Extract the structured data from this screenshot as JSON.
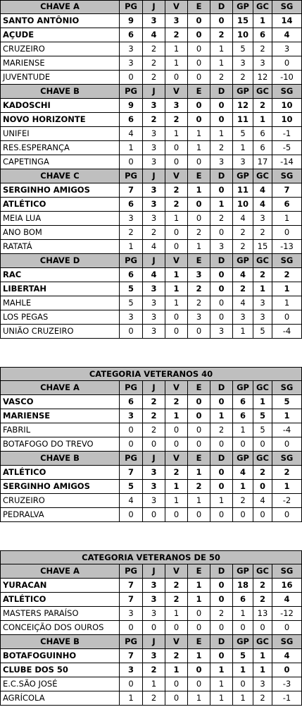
{
  "columns": [
    "PG",
    "J",
    "V",
    "E",
    "D",
    "GP",
    "GC",
    "SG"
  ],
  "sections": [
    {
      "category": "",
      "groups": [
        {
          "title": "CHAVE  A",
          "teams": [
            {
              "name": "SANTO ANTÔNIO",
              "bold": true,
              "stats": [
                "9",
                "3",
                "3",
                "0",
                "0",
                "15",
                "1",
                "14"
              ]
            },
            {
              "name": "AÇUDE",
              "bold": true,
              "stats": [
                "6",
                "4",
                "2",
                "0",
                "2",
                "10",
                "6",
                "4"
              ]
            },
            {
              "name": "CRUZEIRO",
              "bold": false,
              "stats": [
                "3",
                "2",
                "1",
                "0",
                "1",
                "5",
                "2",
                "3"
              ]
            },
            {
              "name": "MARIENSE",
              "bold": false,
              "stats": [
                "3",
                "2",
                "1",
                "0",
                "1",
                "3",
                "3",
                "0"
              ]
            },
            {
              "name": "JUVENTUDE",
              "bold": false,
              "stats": [
                "0",
                "2",
                "0",
                "0",
                "2",
                "2",
                "12",
                "-10"
              ]
            }
          ]
        },
        {
          "title": "CHAVE  B",
          "teams": [
            {
              "name": "KADOSCHI",
              "bold": true,
              "stats": [
                "9",
                "3",
                "3",
                "0",
                "0",
                "12",
                "2",
                "10"
              ]
            },
            {
              "name": "NOVO HORIZONTE",
              "bold": true,
              "stats": [
                "6",
                "2",
                "2",
                "0",
                "0",
                "11",
                "1",
                "10"
              ]
            },
            {
              "name": "UNIFEI",
              "bold": false,
              "stats": [
                "4",
                "3",
                "1",
                "1",
                "1",
                "5",
                "6",
                "-1"
              ]
            },
            {
              "name": "RES.ESPERANÇA",
              "bold": false,
              "stats": [
                "1",
                "3",
                "0",
                "1",
                "2",
                "1",
                "6",
                "-5"
              ]
            },
            {
              "name": "CAPETINGA",
              "bold": false,
              "stats": [
                "0",
                "3",
                "0",
                "0",
                "3",
                "3",
                "17",
                "-14"
              ]
            }
          ]
        },
        {
          "title": "CHAVE C",
          "teams": [
            {
              "name": "SERGINHO AMIGOS",
              "bold": true,
              "stats": [
                "7",
                "3",
                "2",
                "1",
                "0",
                "11",
                "4",
                "7"
              ]
            },
            {
              "name": "ATLÉTICO",
              "bold": true,
              "stats": [
                "6",
                "3",
                "2",
                "0",
                "1",
                "10",
                "4",
                "6"
              ]
            },
            {
              "name": "MEIA LUA",
              "bold": false,
              "stats": [
                "3",
                "3",
                "1",
                "0",
                "2",
                "4",
                "3",
                "1"
              ]
            },
            {
              "name": "ANO BOM",
              "bold": false,
              "stats": [
                "2",
                "2",
                "0",
                "2",
                "0",
                "2",
                "2",
                "0"
              ]
            },
            {
              "name": "RATATÁ",
              "bold": false,
              "stats": [
                "1",
                "4",
                "0",
                "1",
                "3",
                "2",
                "15",
                "-13"
              ]
            }
          ]
        },
        {
          "title": "CHAVE D",
          "teams": [
            {
              "name": "RAC",
              "bold": true,
              "stats": [
                "6",
                "4",
                "1",
                "3",
                "0",
                "4",
                "2",
                "2"
              ]
            },
            {
              "name": "LIBERTAH",
              "bold": true,
              "stats": [
                "5",
                "3",
                "1",
                "2",
                "0",
                "2",
                "1",
                "1"
              ]
            },
            {
              "name": "MAHLE",
              "bold": false,
              "stats": [
                "5",
                "3",
                "1",
                "2",
                "0",
                "4",
                "3",
                "1"
              ]
            },
            {
              "name": "LOS PEGAS",
              "bold": false,
              "stats": [
                "3",
                "3",
                "0",
                "3",
                "0",
                "3",
                "3",
                "0"
              ]
            },
            {
              "name": "UNIÃO CRUZEIRO",
              "bold": false,
              "stats": [
                "0",
                "3",
                "0",
                "0",
                "3",
                "1",
                "5",
                "-4"
              ]
            }
          ]
        }
      ]
    },
    {
      "category": "CATEGORIA VETERANOS 40",
      "groups": [
        {
          "title": "CHAVE  A",
          "teams": [
            {
              "name": "VASCO",
              "bold": true,
              "stats": [
                "6",
                "2",
                "2",
                "0",
                "0",
                "6",
                "1",
                "5"
              ]
            },
            {
              "name": "MARIENSE",
              "bold": true,
              "stats": [
                "3",
                "2",
                "1",
                "0",
                "1",
                "6",
                "5",
                "1"
              ]
            },
            {
              "name": "FABRIL",
              "bold": false,
              "stats": [
                "0",
                "2",
                "0",
                "0",
                "2",
                "1",
                "5",
                "-4"
              ]
            },
            {
              "name": "BOTAFOGO DO TREVO",
              "bold": false,
              "stats": [
                "0",
                "0",
                "0",
                "0",
                "0",
                "0",
                "0",
                "0"
              ]
            }
          ]
        },
        {
          "title": "CHAVE  B",
          "teams": [
            {
              "name": "ATLÉTICO",
              "bold": true,
              "stats": [
                "7",
                "3",
                "2",
                "1",
                "0",
                "4",
                "2",
                "2"
              ]
            },
            {
              "name": "SERGINHO AMIGOS",
              "bold": true,
              "stats": [
                "5",
                "3",
                "1",
                "2",
                "0",
                "1",
                "0",
                "1"
              ]
            },
            {
              "name": "CRUZEIRO",
              "bold": false,
              "stats": [
                "4",
                "3",
                "1",
                "1",
                "1",
                "2",
                "4",
                "-2"
              ]
            },
            {
              "name": "PEDRALVA",
              "bold": false,
              "stats": [
                "0",
                "0",
                "0",
                "0",
                "0",
                "0",
                "0",
                "0"
              ]
            }
          ]
        }
      ]
    },
    {
      "category": "CATEGORIA  VETERANOS DE 50",
      "groups": [
        {
          "title": "CHAVE  A",
          "teams": [
            {
              "name": "YURACAN",
              "bold": true,
              "stats": [
                "7",
                "3",
                "2",
                "1",
                "0",
                "18",
                "2",
                "16"
              ]
            },
            {
              "name": "ATLÉTICO",
              "bold": true,
              "stats": [
                "7",
                "3",
                "2",
                "1",
                "0",
                "6",
                "2",
                "4"
              ]
            },
            {
              "name": "MASTERS PARAÍSO",
              "bold": false,
              "stats": [
                "3",
                "3",
                "1",
                "0",
                "2",
                "1",
                "13",
                "-12"
              ]
            },
            {
              "name": "CONCEIÇÃO DOS OUROS",
              "bold": false,
              "stats": [
                "0",
                "0",
                "0",
                "0",
                "0",
                "0",
                "0",
                "0"
              ]
            }
          ]
        },
        {
          "title": "CHAVE  B",
          "teams": [
            {
              "name": "BOTAFOGUINHO",
              "bold": true,
              "stats": [
                "7",
                "3",
                "2",
                "1",
                "0",
                "5",
                "1",
                "4"
              ]
            },
            {
              "name": "CLUBE DOS 50",
              "bold": true,
              "stats": [
                "3",
                "2",
                "1",
                "0",
                "1",
                "1",
                "1",
                "0"
              ]
            },
            {
              "name": "E.C.SÃO JOSÉ",
              "bold": false,
              "stats": [
                "0",
                "1",
                "0",
                "0",
                "1",
                "0",
                "3",
                "-3"
              ]
            },
            {
              "name": "AGRÍCOLA",
              "bold": false,
              "stats": [
                "1",
                "2",
                "0",
                "1",
                "1",
                "1",
                "2",
                "-1"
              ]
            }
          ]
        }
      ]
    }
  ]
}
